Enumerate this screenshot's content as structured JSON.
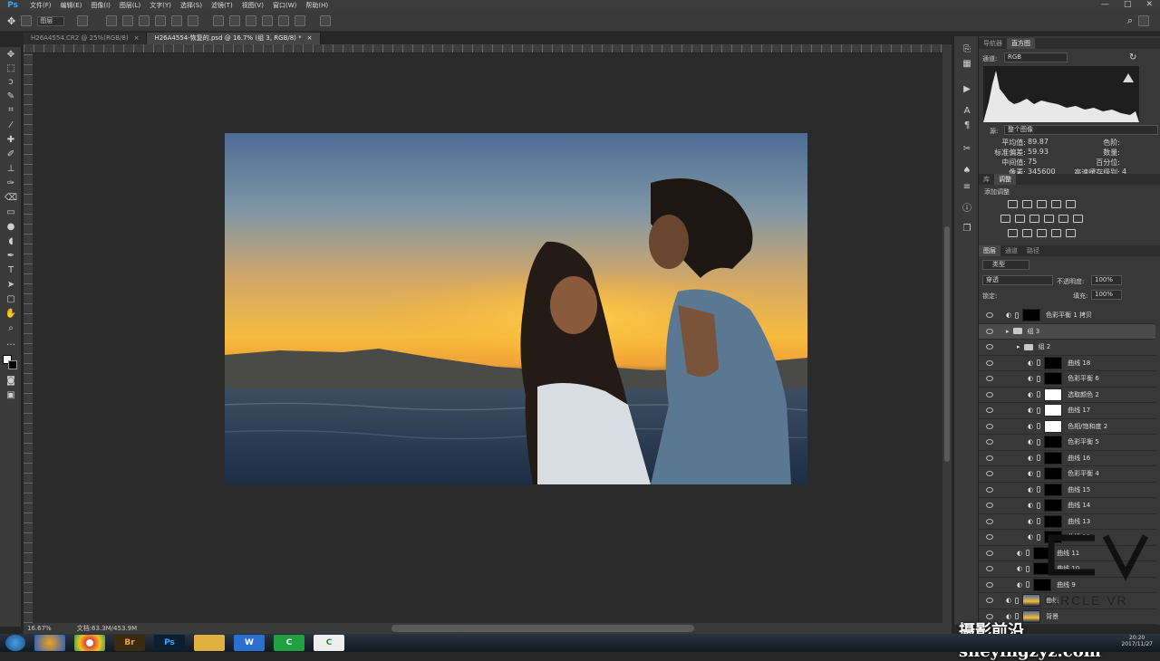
{
  "app": {
    "logo": "Ps"
  },
  "menu": [
    "文件(F)",
    "编辑(E)",
    "图像(I)",
    "图层(L)",
    "文字(Y)",
    "选择(S)",
    "滤镜(T)",
    "视图(V)",
    "窗口(W)",
    "帮助(H)"
  ],
  "window_controls": [
    "—",
    "□",
    "✕"
  ],
  "options": {
    "align_select": "图层"
  },
  "doc_tabs": [
    {
      "label": "H26A4554.CR2 @ 25%(RGB/8)",
      "close": "×",
      "active": false
    },
    {
      "label": "H26A4554-恢复的.psd @ 16.7% (组 3, RGB/8) *",
      "close": "×",
      "active": true
    }
  ],
  "status": {
    "zoom": "16.67%",
    "doc": "文档:63.3M/453.9M"
  },
  "histogram": {
    "tabs": [
      "导航器",
      "直方图"
    ],
    "channel_label": "通道:",
    "channel_value": "RGB",
    "source_label": "源:",
    "source_value": "整个图像",
    "stats": [
      {
        "label": "平均值:",
        "value": "89.87"
      },
      {
        "label": "标准偏差:",
        "value": "59.93"
      },
      {
        "label": "中间值:",
        "value": "75"
      },
      {
        "label": "像素:",
        "value": "345600"
      }
    ],
    "stats_right": [
      {
        "label": "色阶:",
        "value": ""
      },
      {
        "label": "数量:",
        "value": ""
      },
      {
        "label": "百分位:",
        "value": ""
      },
      {
        "label": "高速缓存级别:",
        "value": "4"
      }
    ]
  },
  "adjustments": {
    "tabs": [
      "库",
      "调整"
    ],
    "title": "添加调整"
  },
  "layers_panel": {
    "tabs": [
      "图层",
      "通道",
      "路径"
    ],
    "kind": "类型",
    "blend": "穿透",
    "opacity_label": "不透明度:",
    "opacity": "100%",
    "lock_label": "锁定:",
    "fill_label": "填充:",
    "fill": "100%",
    "layers": [
      {
        "name": "色彩平衡 1 拷贝",
        "indent": 0,
        "thumb": "dark",
        "sel": false
      },
      {
        "name": "组 3",
        "indent": 0,
        "thumb": "folder",
        "sel": true
      },
      {
        "name": "组 2",
        "indent": 1,
        "thumb": "folder",
        "sel": false
      },
      {
        "name": "曲线 18",
        "indent": 2,
        "thumb": "dark",
        "sel": false
      },
      {
        "name": "色彩平衡 6",
        "indent": 2,
        "thumb": "dark",
        "sel": false
      },
      {
        "name": "选取颜色 2",
        "indent": 2,
        "thumb": "white",
        "sel": false
      },
      {
        "name": "曲线 17",
        "indent": 2,
        "thumb": "white",
        "sel": false
      },
      {
        "name": "色相/饱和度 2",
        "indent": 2,
        "thumb": "white",
        "sel": false
      },
      {
        "name": "色彩平衡 5",
        "indent": 2,
        "thumb": "dark",
        "sel": false
      },
      {
        "name": "曲线 16",
        "indent": 2,
        "thumb": "dark",
        "sel": false
      },
      {
        "name": "色彩平衡 4",
        "indent": 2,
        "thumb": "dark",
        "sel": false
      },
      {
        "name": "曲线 15",
        "indent": 2,
        "thumb": "dark",
        "sel": false
      },
      {
        "name": "曲线 14",
        "indent": 2,
        "thumb": "dark",
        "sel": false
      },
      {
        "name": "曲线 13",
        "indent": 2,
        "thumb": "dark",
        "sel": false
      },
      {
        "name": "曲线 12",
        "indent": 2,
        "thumb": "dark",
        "sel": false
      },
      {
        "name": "曲线 11",
        "indent": 1,
        "thumb": "dark",
        "sel": false
      },
      {
        "name": "曲线 10",
        "indent": 1,
        "thumb": "dark",
        "sel": false
      },
      {
        "name": "曲线 9",
        "indent": 1,
        "thumb": "dark",
        "sel": false
      },
      {
        "name": "曲线",
        "indent": 0,
        "thumb": "photo",
        "sel": false
      },
      {
        "name": "背景",
        "indent": 0,
        "thumb": "photo",
        "sel": false
      }
    ]
  },
  "taskbar": {
    "apps": [
      "Br",
      "Ps",
      "",
      "W",
      "C",
      "C"
    ],
    "time": "20:20",
    "date": "2017/11/27"
  },
  "watermark": {
    "brand": "CIRCLE VR",
    "site": "摄影前沿 sheyingzyz.com"
  },
  "colors": {
    "ps_blue": "#31a8ff",
    "panel": "#383838",
    "canvas": "#2b2b2b"
  }
}
